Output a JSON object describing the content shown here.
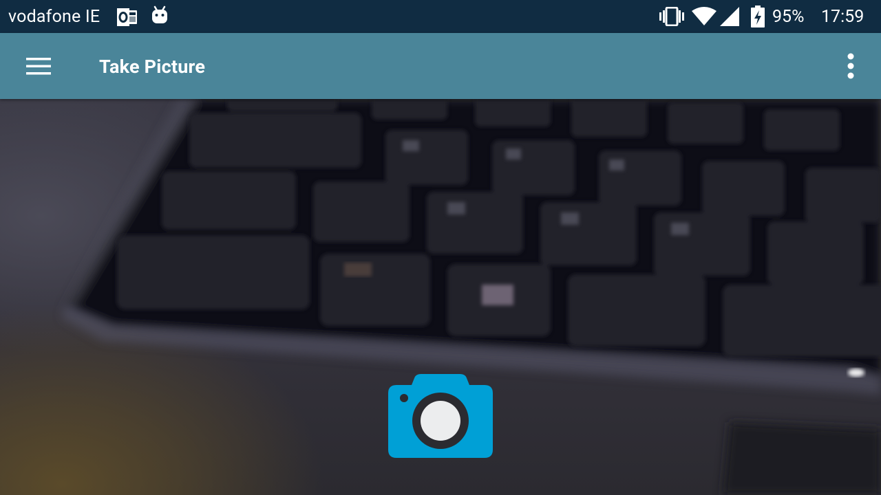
{
  "status_bar": {
    "carrier": "vodafone IE",
    "notification_icons": [
      "outlook-icon",
      "android-debug-icon"
    ],
    "system_icons": [
      "vibrate-icon",
      "wifi-icon",
      "cell-signal-icon",
      "battery-charging-icon"
    ],
    "battery_percent": "95%",
    "time": "17:59"
  },
  "app_bar": {
    "title": "Take Picture",
    "menu_icon": "hamburger-menu-icon",
    "overflow_icon": "more-vert-icon",
    "color": "#4a8599"
  },
  "camera": {
    "shutter_icon": "camera-icon",
    "shutter_color": "#00a0d6"
  }
}
